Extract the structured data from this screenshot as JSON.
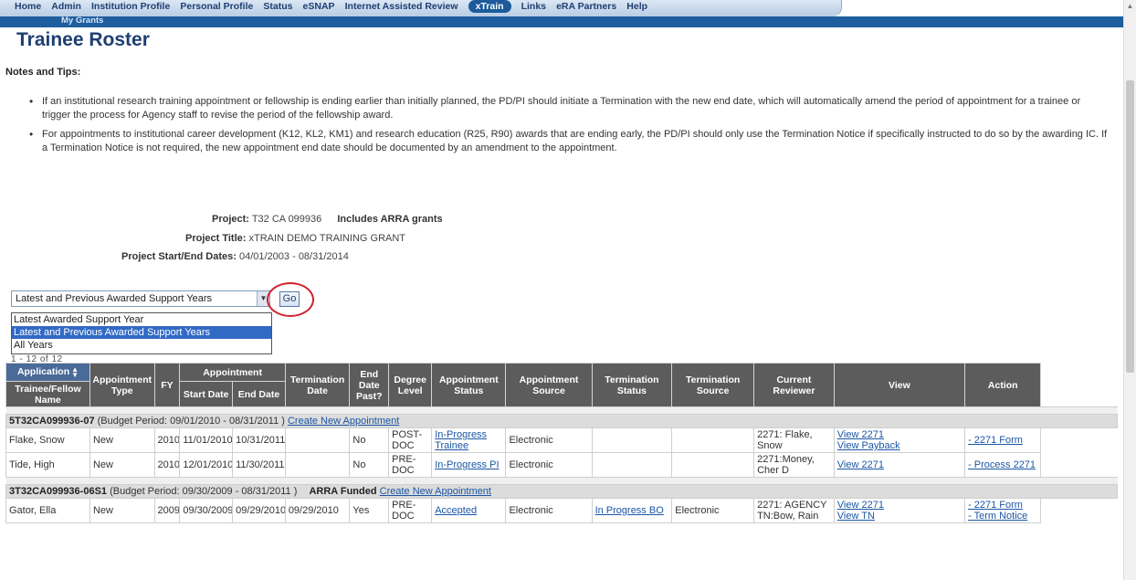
{
  "nav": {
    "items": [
      "Home",
      "Admin",
      "Institution Profile",
      "Personal Profile",
      "Status",
      "eSNAP",
      "Internet Assisted Review",
      "xTrain",
      "Links",
      "eRA Partners",
      "Help"
    ],
    "active": "xTrain",
    "sub_item": "My Grants"
  },
  "page": {
    "title": "Trainee Roster"
  },
  "notes": {
    "heading": "Notes and Tips:",
    "items": [
      "If an institutional research training appointment or fellowship is ending earlier than initially planned, the PD/PI should initiate a Termination with the new end date, which will automatically amend the period of appointment for a trainee or trigger the process for Agency staff to revise the period of the fellowship award.",
      "For appointments to institutional career development (K12, KL2, KM1) and research education (R25, R90) awards that are ending early, the PD/PI should only use the Termination Notice if specifically instructed to do so by the awarding IC.  If a Termination Notice is not required, the new appointment end date should be documented by an amendment to the appointment."
    ]
  },
  "project": {
    "project_label": "Project:",
    "project_value": "T32 CA 099936",
    "arra_note": "Includes ARRA grants",
    "title_label": "Project Title:",
    "title_value": "xTRAIN DEMO TRAINING GRANT",
    "dates_label": "Project Start/End Dates:",
    "dates_value": "04/01/2003 - 08/31/2014"
  },
  "filter": {
    "selected": "Latest and Previous Awarded Support Years",
    "go_label": "Go",
    "options": [
      "Latest Awarded Support Year",
      "Latest and Previous Awarded Support Years",
      "All Years"
    ],
    "selected_index": 1
  },
  "paging_text": "1 - 12 of 12",
  "table": {
    "headers": {
      "application": "Application",
      "trainee_name": "Trainee/Fellow Name",
      "appointment_type": "Appointment Type",
      "fy": "FY",
      "appointment": "Appointment",
      "start_date": "Start Date",
      "end_date": "End Date",
      "termination_date": "Termination Date",
      "end_date_past": "End Date Past?",
      "degree_level": "Degree Level",
      "appointment_status": "Appointment Status",
      "appointment_source": "Appointment Source",
      "termination_status": "Termination Status",
      "termination_source": "Termination Source",
      "current_reviewer": "Current Reviewer",
      "view": "View",
      "action": "Action"
    },
    "groups": [
      {
        "grant_id": "5T32CA099936-07",
        "budget_period": "(Budget Period: 09/01/2010 - 08/31/2011 )",
        "arra": "",
        "create_link": "Create New Appointment",
        "rows": [
          {
            "name": "Flake, Snow",
            "type": "New",
            "fy": "2010",
            "start": "11/01/2010",
            "end": "10/31/2011",
            "term_date": "",
            "past": "No",
            "degree": "POST-DOC",
            "status": "In-Progress Trainee",
            "source": "Electronic",
            "term_status": "",
            "term_source": "",
            "reviewer": "2271: Flake, Snow",
            "view": [
              "View 2271",
              "View Payback"
            ],
            "action": [
              "- 2271 Form"
            ]
          },
          {
            "name": "Tide, High",
            "type": "New",
            "fy": "2010",
            "start": "12/01/2010",
            "end": "11/30/2011",
            "term_date": "",
            "past": "No",
            "degree": "PRE-DOC",
            "status": "In-Progress PI",
            "source": "Electronic",
            "term_status": "",
            "term_source": "",
            "reviewer": "2271:Money, Cher D",
            "view": [
              "View 2271"
            ],
            "action": [
              "- Process 2271"
            ]
          }
        ]
      },
      {
        "grant_id": "3T32CA099936-06S1",
        "budget_period": "(Budget Period: 09/30/2009 - 08/31/2011 )",
        "arra": "ARRA Funded",
        "create_link": "Create New Appointment",
        "rows": [
          {
            "name": "Gator, Ella",
            "type": "New",
            "fy": "2009",
            "start": "09/30/2009",
            "end": "09/29/2010",
            "term_date": "09/29/2010",
            "past": "Yes",
            "degree": "PRE-DOC",
            "status": "Accepted",
            "source": "Electronic",
            "term_status": "In Progress BO",
            "term_source": "Electronic",
            "reviewer": "2271: AGENCY TN:Bow, Rain",
            "view": [
              "View 2271",
              "View TN"
            ],
            "action": [
              "- 2271 Form",
              "- Term Notice"
            ]
          }
        ]
      }
    ]
  }
}
